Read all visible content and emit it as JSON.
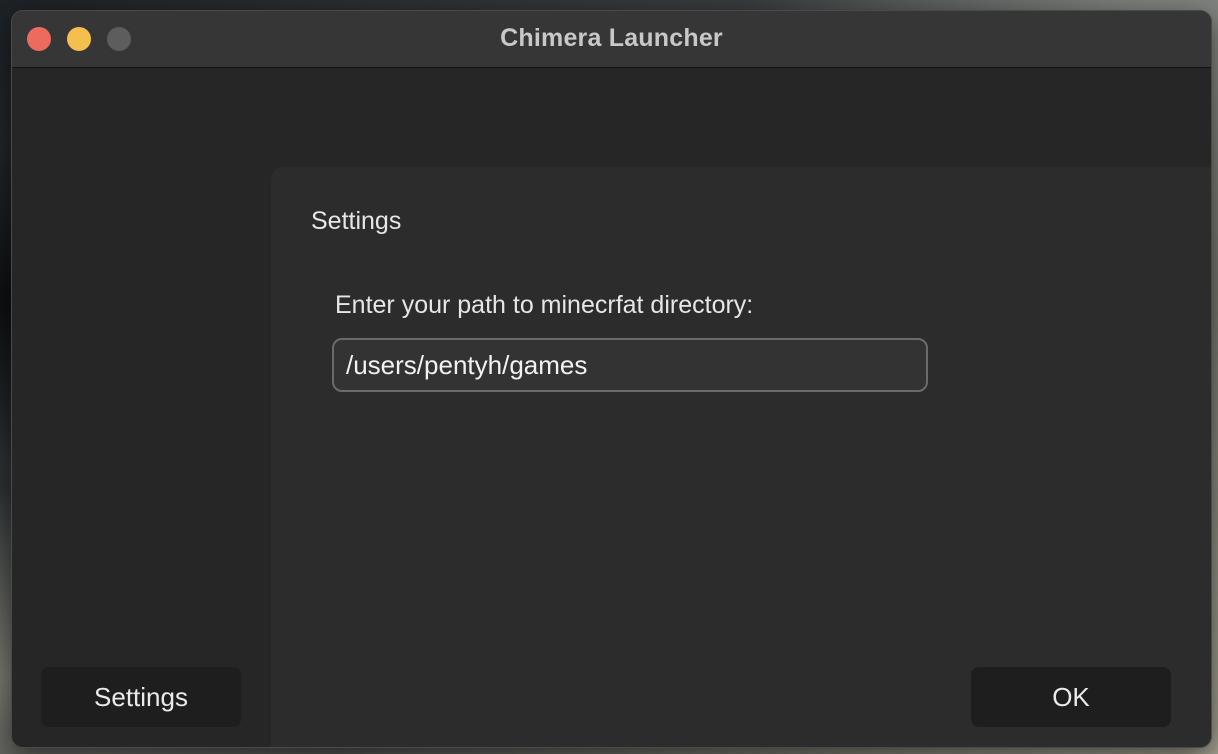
{
  "window": {
    "title": "Chimera Launcher",
    "traffic_lights": {
      "close_color": "#ed6a5e",
      "minimize_color": "#f5bf4f",
      "zoom_color": "#5d5d5d"
    }
  },
  "sidebar": {
    "settings_button_label": "Settings"
  },
  "settings_panel": {
    "title": "Settings",
    "path_label": "Enter your path to minecrfat directory:",
    "path_value": "/users/pentyh/games",
    "ok_label": "OK"
  }
}
